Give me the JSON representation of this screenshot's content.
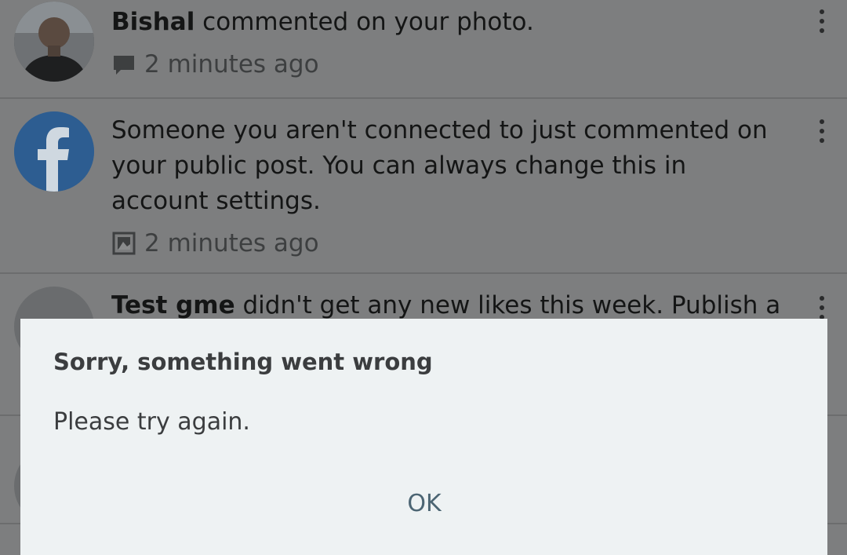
{
  "notifications": [
    {
      "actor": "Bishal",
      "message": " commented on your photo.",
      "meta_icon": "comment-icon",
      "time": "2 minutes ago",
      "avatar": "user-avatar"
    },
    {
      "actor": "",
      "message": "Someone you aren't connected to just commented on your public post. You can always change this in account settings.",
      "meta_icon": "photo-icon",
      "time": "2 minutes ago",
      "avatar": "facebook-logo"
    },
    {
      "actor": "Test gme",
      "message": " didn't get any new likes this week. Publish a",
      "avatar": "page-avatar"
    }
  ],
  "dialog": {
    "title": "Sorry, something went wrong",
    "message": "Please try again.",
    "ok_label": "OK"
  },
  "colors": {
    "overlay_background": "#7d7e7f",
    "dialog_background": "#eef2f3",
    "facebook_blue": "#2d5d91",
    "ok_text": "#4c6573"
  }
}
